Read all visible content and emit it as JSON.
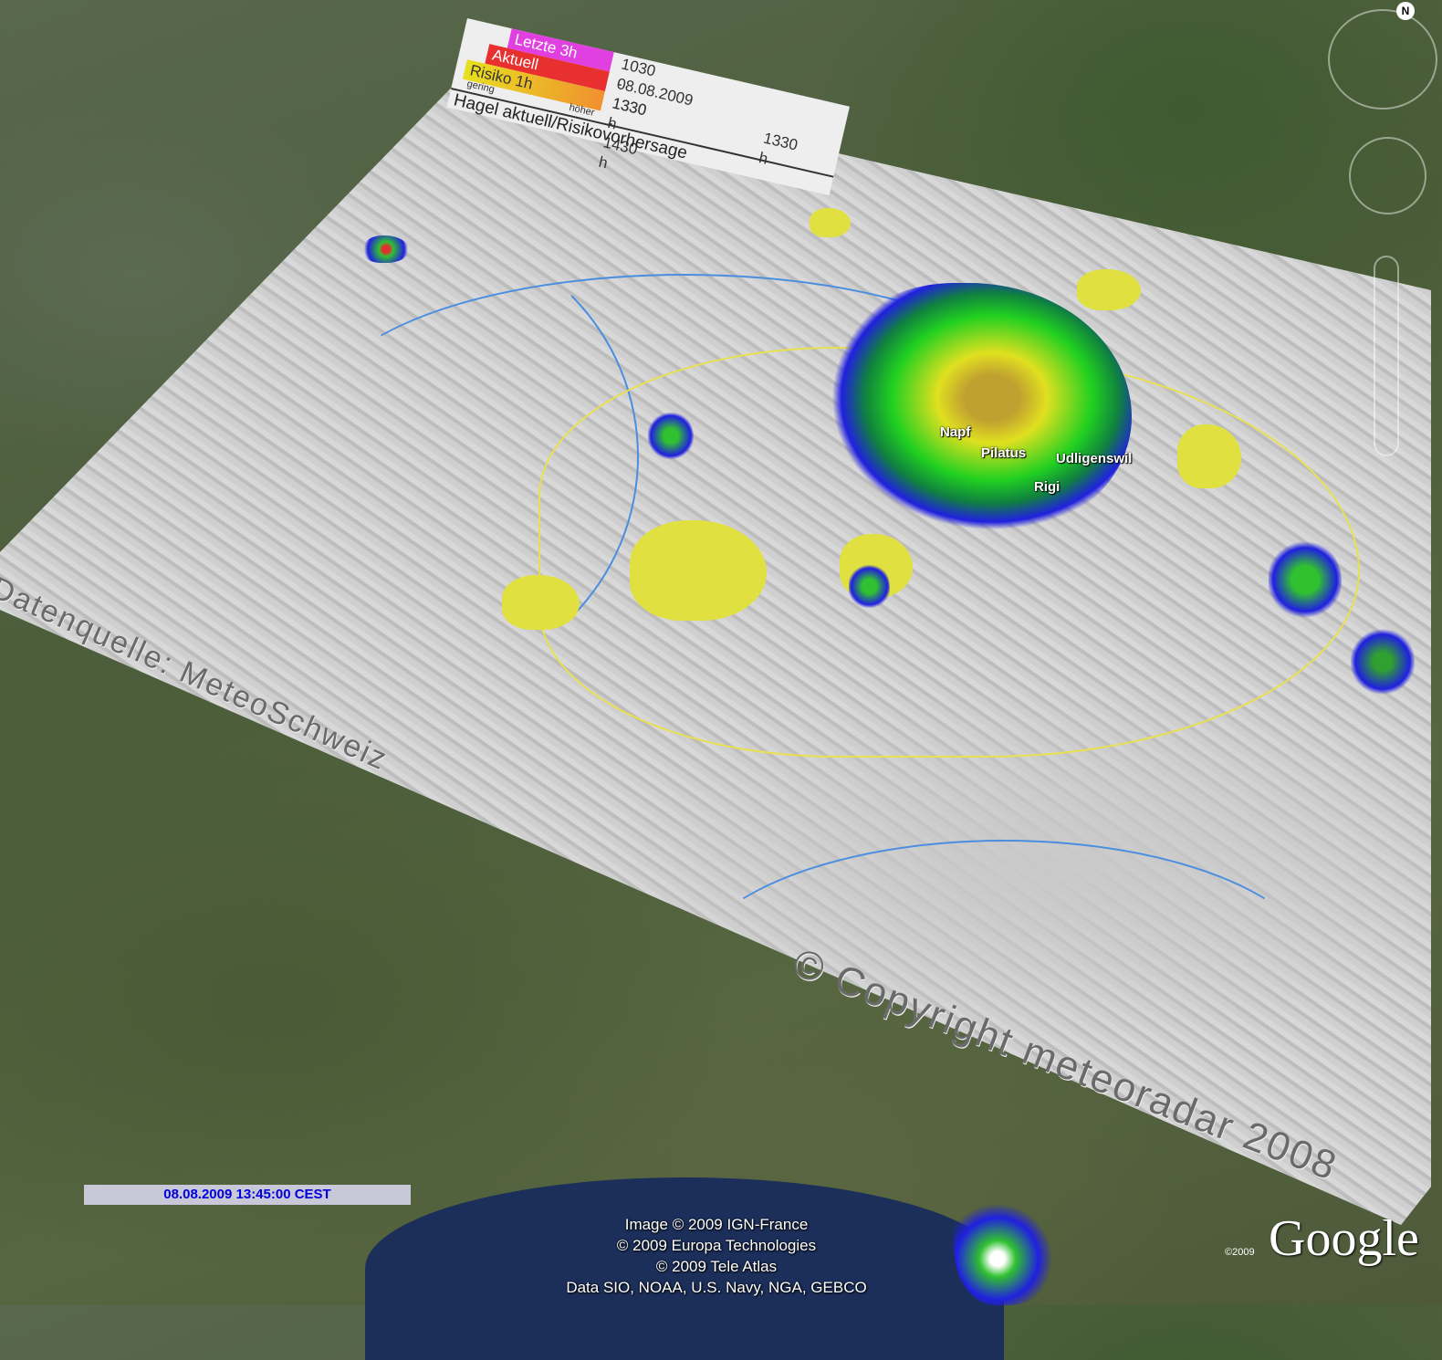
{
  "legend": {
    "items": [
      {
        "label": "Letzte 3h",
        "color": "#e040e0",
        "time": "1030 - 1330 h"
      },
      {
        "label": "Aktuell",
        "color": "#e83030",
        "time": "08.08.2009"
      },
      {
        "label": "Risiko 1h",
        "color": "#e8e020",
        "time": "1330 - 1430 h"
      }
    ],
    "sub_left": "gering",
    "sub_right": "höher",
    "current_time": "1330 h",
    "title": "Hagel aktuell/Risikovorhersage"
  },
  "places": [
    "Napf",
    "Pilatus",
    "Udligenswil",
    "Rigi"
  ],
  "watermarks": {
    "source": "Datenquelle: MeteoSchweiz",
    "copyright": "© Copyright meteoradar 2008"
  },
  "timestamp": "08.08.2009 13:45:00 CEST",
  "attribution": [
    "Image © 2009 IGN-France",
    "© 2009 Europa Technologies",
    "© 2009 Tele Atlas",
    "Data SIO, NOAA, U.S. Navy, NGA, GEBCO"
  ],
  "logo": {
    "year": "©2009",
    "name": "Google"
  },
  "compass": "N"
}
